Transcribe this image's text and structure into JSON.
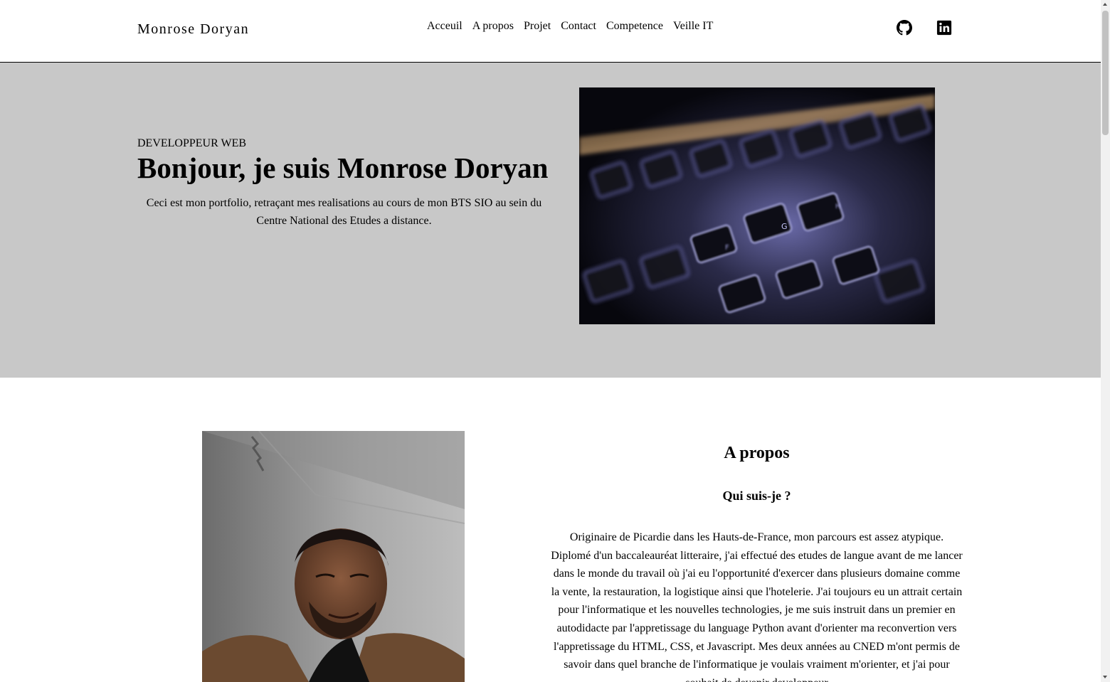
{
  "header": {
    "brand": "Monrose Doryan",
    "nav": [
      "Acceuil",
      "A propos",
      "Projet",
      "Contact",
      "Competence",
      "Veille IT"
    ],
    "social": [
      "github-icon",
      "linkedin-icon"
    ]
  },
  "hero": {
    "kicker": "DEVELOPPEUR WEB",
    "title": "Bonjour, je suis Monrose Doryan",
    "description": "Ceci est mon portfolio, retraçant mes realisations au cours de mon BTS SIO au sein du Centre National des Etudes a distance.",
    "background": "#c8c8c8",
    "image": "keyboard-photo"
  },
  "about": {
    "title": "A propos",
    "subtitle": "Qui suis-je ?",
    "text": "Originaire de Picardie dans les Hauts-de-France, mon parcours est assez atypique. Diplomé d'un baccaleauréat litteraire, j'ai effectué des etudes de langue avant de me lancer dans le monde du travail où j'ai eu l'opportunité d'exercer dans plusieurs domaine comme la vente, la restauration, la logistique ainsi que l'hotelerie. J'ai toujours eu un attrait certain pour l'informatique et les nouvelles technologies, je me suis instruit dans un premier en autodidacte par l'appretissage du language Python avant d'orienter ma reconvertion vers l'appretissage du HTML, CSS, et Javascript. Mes deux années au CNED m'ont permis de savoir dans quel branche de l'informatique je voulais vraiment m'orienter, et j'ai pour souhait de devenir developpeur",
    "image": "portrait-photo"
  }
}
